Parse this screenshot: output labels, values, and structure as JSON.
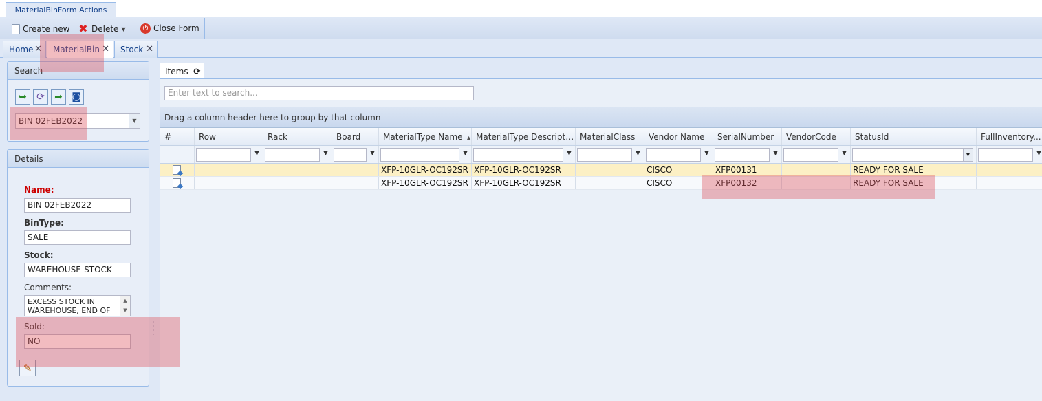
{
  "ribbon": {
    "tab_label": "MaterialBinForm Actions"
  },
  "toolbar": {
    "create_label": "Create new",
    "delete_label": "Delete",
    "close_label": "Close Form"
  },
  "tabs": [
    {
      "label": "Home"
    },
    {
      "label": "MaterialBin"
    },
    {
      "label": "Stock"
    }
  ],
  "search_panel": {
    "title": "Search",
    "selected_bin": "BIN 02FEB2022"
  },
  "details_panel": {
    "title": "Details",
    "name_label": "Name:",
    "name_value": "BIN 02FEB2022",
    "bintype_label": "BinType:",
    "bintype_value": "SALE",
    "stock_label": "Stock:",
    "stock_value": "WAREHOUSE-STOCK",
    "comments_label": "Comments:",
    "comments_value": "EXCESS STOCK IN WAREHOUSE, END OF",
    "sold_label": "Sold:",
    "sold_value": "NO"
  },
  "items": {
    "tab_label": "Items",
    "search_placeholder": "Enter text to search...",
    "group_hint": "Drag a column header here to group by that column",
    "columns": [
      "#",
      "Row",
      "Rack",
      "Board",
      "MaterialType Name",
      "MaterialType Descripti...",
      "MaterialClass",
      "Vendor Name",
      "SerialNumber",
      "VendorCode",
      "StatusId",
      "FullInventory..."
    ],
    "rows": [
      {
        "row": "",
        "rack": "",
        "board": "",
        "mt_name": "XFP-10GLR-OC192SR",
        "mt_desc": "XFP-10GLR-OC192SR",
        "mclass": "",
        "vendor": "CISCO",
        "serial": "XFP00131",
        "vcode": "",
        "status": "READY FOR SALE",
        "full": ""
      },
      {
        "row": "",
        "rack": "",
        "board": "",
        "mt_name": "XFP-10GLR-OC192SR",
        "mt_desc": "XFP-10GLR-OC192SR",
        "mclass": "",
        "vendor": "CISCO",
        "serial": "XFP00132",
        "vcode": "",
        "status": "READY FOR SALE",
        "full": ""
      }
    ]
  },
  "icons": [
    "doc-icon",
    "delete-x-icon",
    "close-form-icon",
    "refresh-icon",
    "pencil-icon",
    "binoculars-icon"
  ]
}
